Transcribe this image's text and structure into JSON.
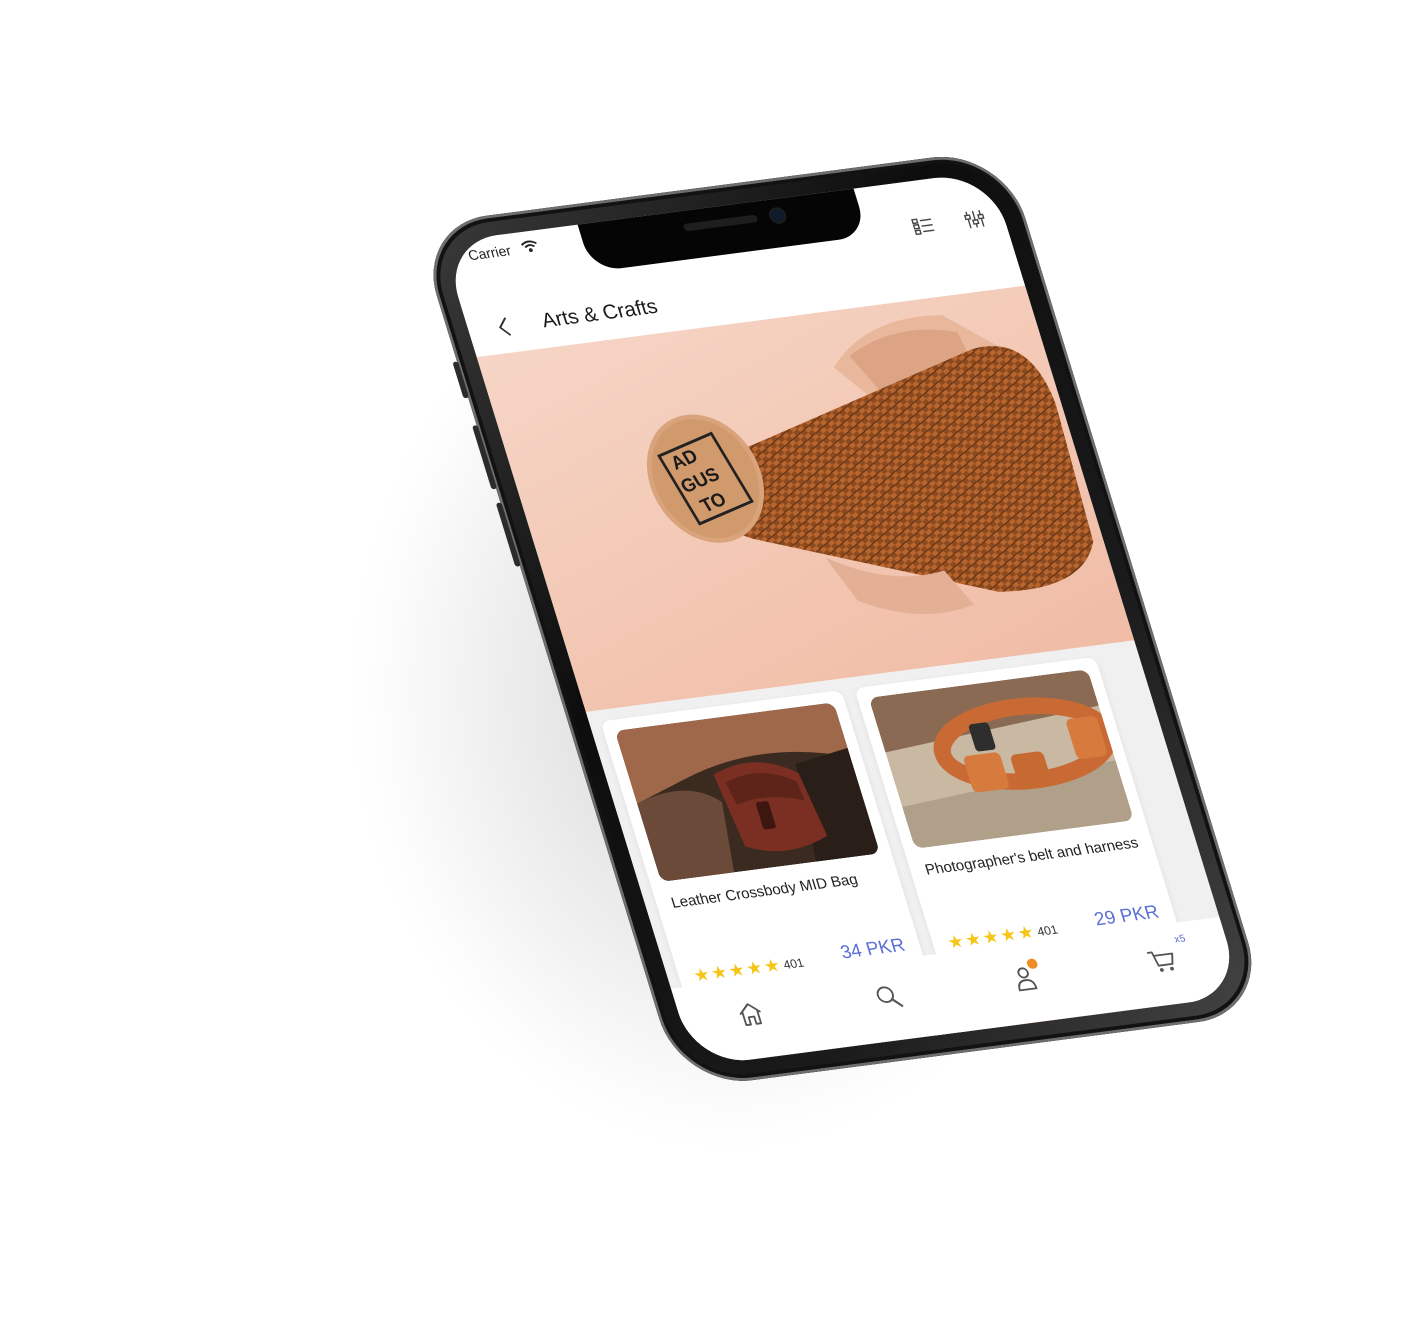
{
  "status_bar": {
    "carrier": "Carrier"
  },
  "header": {
    "title": "Arts & Crafts",
    "back_icon": "chevron-left-icon",
    "actions": [
      "list-view-icon",
      "filter-sliders-icon"
    ]
  },
  "hero": {
    "brand_mark": [
      "AD",
      "GUS",
      "TO"
    ]
  },
  "products": [
    {
      "title": "Leather Crossbody MID Bag",
      "rating_stars": 5,
      "reviews": "401",
      "price": "34 PKR"
    },
    {
      "title": "Photographer's belt and harness",
      "rating_stars": 5,
      "reviews": "401",
      "price": "29 PKR"
    }
  ],
  "bottom_nav": {
    "tabs": [
      "home-icon",
      "search-icon",
      "profile-icon",
      "cart-icon"
    ],
    "cart_count": "x5"
  },
  "colors": {
    "accent": "#5b6fd6",
    "star": "#f5c518",
    "badge": "#f08a24",
    "hero_bg": "#f3c7b3",
    "grid_bg": "#f0f0f0"
  }
}
